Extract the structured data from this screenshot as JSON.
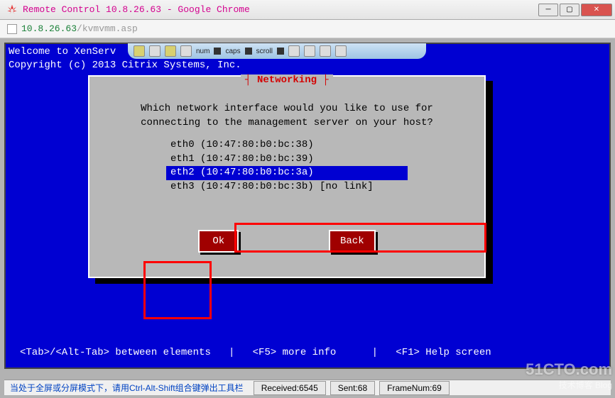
{
  "window": {
    "title": "Remote Control 10.8.26.63 - Google Chrome",
    "url_host": "10.8.26.63",
    "url_path": "/kvmvmm.asp"
  },
  "toolbar": {
    "indicators": [
      "num",
      "caps",
      "scroll"
    ]
  },
  "terminal": {
    "welcome_line1": "Welcome to XenServ",
    "welcome_line2": "Copyright (c) 2013 Citrix Systems, Inc.",
    "help_line": "<Tab>/<Alt-Tab> between elements   |   <F5> more info      |   <F1> Help screen"
  },
  "dialog": {
    "title": "Networking",
    "prompt_line1": "Which network interface would you like to use for",
    "prompt_line2": "connecting to the management server on your host?",
    "interfaces": [
      {
        "label": "eth0 (10:47:80:b0:bc:38)",
        "selected": false
      },
      {
        "label": "eth1 (10:47:80:b0:bc:39)",
        "selected": false
      },
      {
        "label": "eth2 (10:47:80:b0:bc:3a)",
        "selected": true
      },
      {
        "label": "eth3 (10:47:80:b0:bc:3b) [no link]",
        "selected": false
      }
    ],
    "ok_label": "Ok",
    "back_label": "Back"
  },
  "status": {
    "message": "当处于全屏或分屏模式下，请用Ctrl-Alt-Shift组合键弹出工具栏",
    "received": "Received:6545",
    "sent": "Sent:68",
    "frame": "FrameNum:69"
  },
  "watermark": {
    "big": "51CTO.com",
    "small": "技术博客      Blog"
  }
}
